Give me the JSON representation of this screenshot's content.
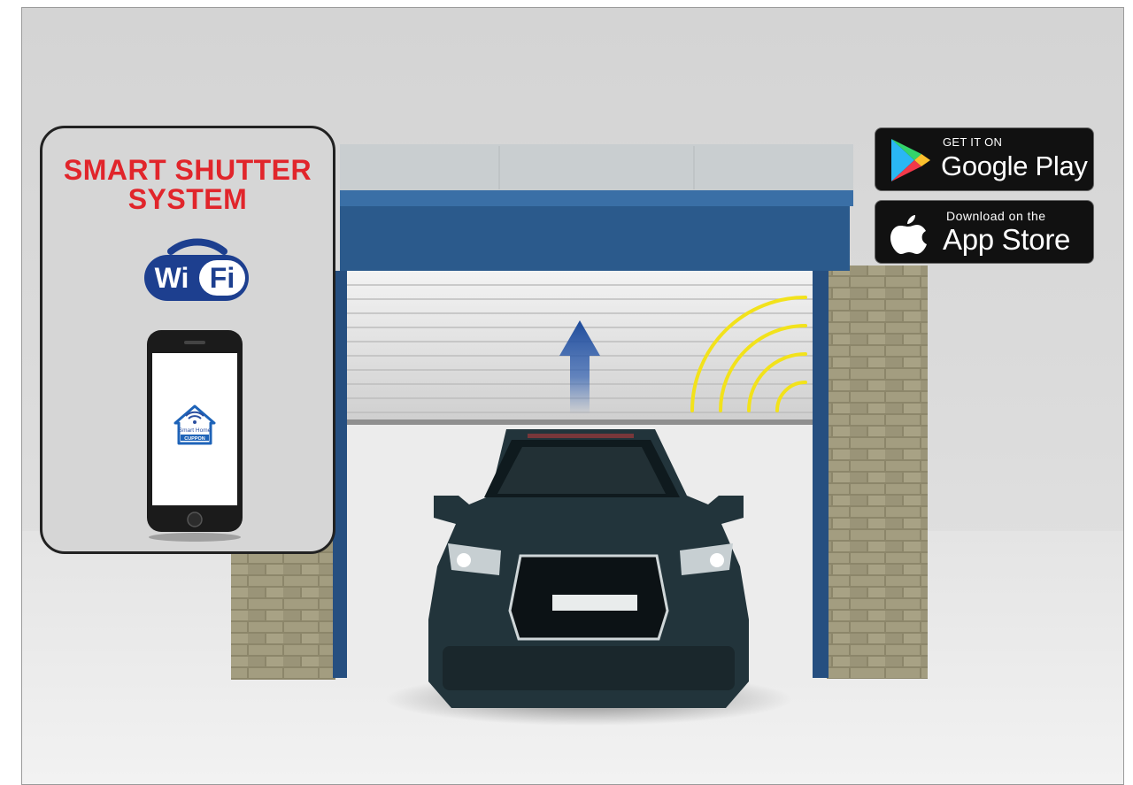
{
  "panel": {
    "title_line1": "SMART SHUTTER",
    "title_line2": "SYSTEM",
    "wifi_wi": "Wi",
    "wifi_fi": "Fi",
    "app_label_line1": "Smart Home",
    "app_label_line2": "CUPPON"
  },
  "badges": {
    "google_play": {
      "small": "GET IT ON",
      "big": "Google Play"
    },
    "app_store": {
      "small": "Download on the",
      "big": "App Store"
    }
  },
  "colors": {
    "title_red": "#e1252b",
    "shutter_blue": "#2b5a8c",
    "wifi_yellow": "#f2e21b",
    "car": "#22343b"
  },
  "icons": [
    "wifi-logo-icon",
    "smartphone-icon",
    "smart-home-app-icon",
    "up-arrow-icon",
    "wireless-signal-icon",
    "google-play-icon",
    "apple-icon"
  ]
}
